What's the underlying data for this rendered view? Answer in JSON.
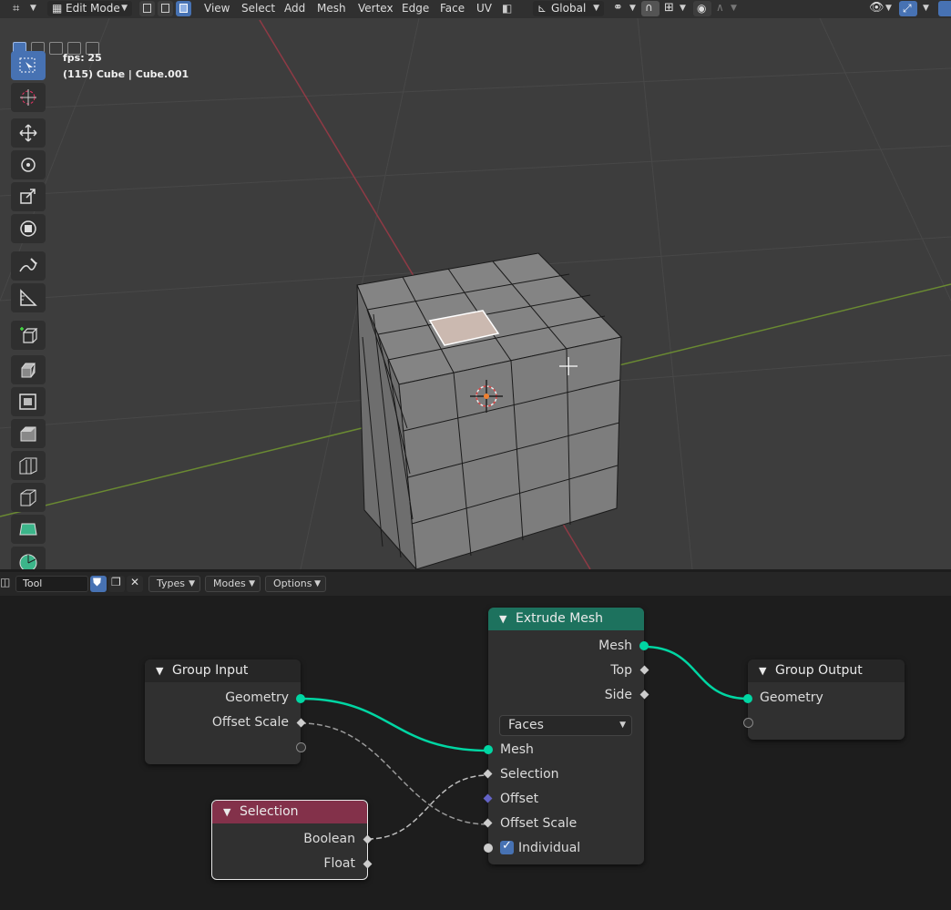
{
  "header": {
    "mode_label": "Edit Mode",
    "menus": [
      "View",
      "Select",
      "Add",
      "Mesh",
      "Vertex",
      "Edge",
      "Face",
      "UV"
    ],
    "transform_orientation": "Global"
  },
  "viewport": {
    "fps_text": "fps: 25",
    "object_info": "(115) Cube | Cube.001"
  },
  "node_header": {
    "tool_field": "Tool",
    "menus": [
      "Types",
      "Modes",
      "Options"
    ]
  },
  "nodes": {
    "extrude_mesh": {
      "title": "Extrude Mesh",
      "outputs": [
        "Mesh",
        "Top",
        "Side"
      ],
      "mode_value": "Faces",
      "inputs": [
        "Mesh",
        "Selection",
        "Offset",
        "Offset Scale"
      ],
      "individual_label": "Individual",
      "individual_checked": true
    },
    "group_input": {
      "title": "Group Input",
      "outputs": [
        "Geometry",
        "Offset Scale"
      ]
    },
    "group_output": {
      "title": "Group Output",
      "inputs": [
        "Geometry"
      ]
    },
    "selection": {
      "title": "Selection",
      "outputs": [
        "Boolean",
        "Float"
      ]
    }
  },
  "colors": {
    "accent_blue": "#4772b3",
    "geometry_socket": "#00d6a3",
    "geometry_header": "#1d725e",
    "input_header": "#83314a",
    "offset_socket": "#6363c7"
  }
}
